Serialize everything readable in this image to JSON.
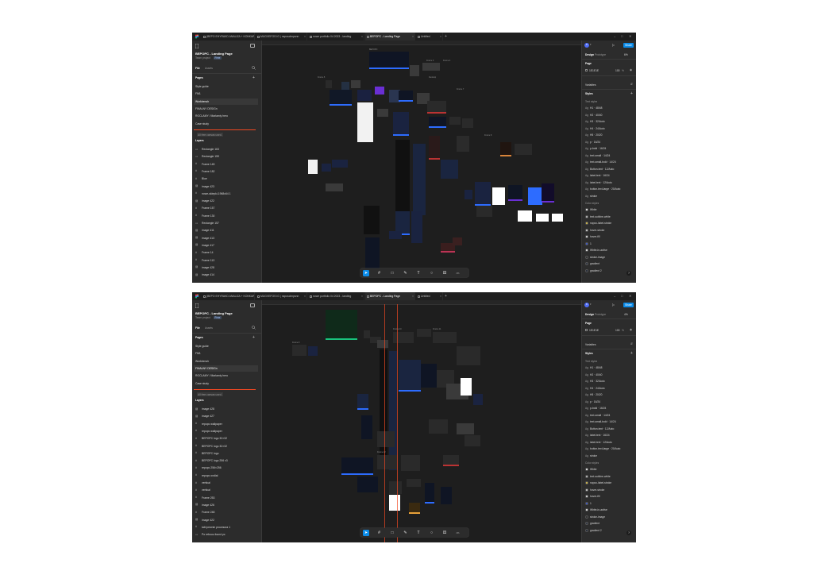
{
  "screenshots": [
    {
      "tabs": [
        {
          "label": "(BEPO EHYRAKD ANALIZA + KONKUR",
          "active": false
        },
        {
          "label": "MUGVEFOS IG | nsposclmpsnn",
          "active": false
        },
        {
          "label": "nowe portfolio 04 2023 - landing",
          "active": false
        },
        {
          "label": "BEPOPC - Landing Page",
          "active": true
        },
        {
          "label": "Untitled",
          "active": false
        }
      ],
      "file": {
        "title": "BEPOPC - Landing Page",
        "team": "Team project",
        "badge": "Free"
      },
      "file_tabs": {
        "file": "File",
        "assets": "Assets"
      },
      "pages_label": "Pages",
      "pages": [
        {
          "name": "Style guide",
          "selected": false
        },
        {
          "name": "FM1",
          "selected": false
        },
        {
          "name": "Workbench",
          "selected": true
        },
        {
          "name": "FINALNY DESIGn",
          "selected": false
        },
        {
          "name": "ROCLAMY / Marlamiy hero",
          "selected": false
        },
        {
          "name": "Case study",
          "selected": false
        }
      ],
      "all_free": "All free canvas used.",
      "layers_label": "Layers",
      "layers": [
        {
          "icon": "rect",
          "name": "Rectangle 163"
        },
        {
          "icon": "rect",
          "name": "Rectangle 159"
        },
        {
          "icon": "frame",
          "name": "Frame 145"
        },
        {
          "icon": "frame",
          "name": "Frame 182"
        },
        {
          "icon": "frame",
          "name": "Blue"
        },
        {
          "icon": "image",
          "name": "image 423"
        },
        {
          "icon": "frame",
          "name": "nowe-sklepki-1968x64 1"
        },
        {
          "icon": "image",
          "name": "image 422"
        },
        {
          "icon": "frame",
          "name": "Frame 157"
        },
        {
          "icon": "frame",
          "name": "Frame 130"
        },
        {
          "icon": "rect",
          "name": "Rectangle 157"
        },
        {
          "icon": "image",
          "name": "image 411"
        },
        {
          "icon": "image",
          "name": "image 413"
        },
        {
          "icon": "image",
          "name": "image 417"
        },
        {
          "icon": "frame",
          "name": "Frame 14"
        },
        {
          "icon": "frame",
          "name": "Frame 113"
        },
        {
          "icon": "image",
          "name": "image 428"
        },
        {
          "icon": "image",
          "name": "image 414"
        }
      ],
      "right": {
        "design": "Design",
        "prototype": "Prototype",
        "zoom": "6%",
        "page_label": "Page",
        "page_color": "1E1E1E",
        "page_opacity": "100",
        "page_percent": "%",
        "variables": "Variables",
        "styles": "Styles",
        "text_styles": "Text styles",
        "text_styles_list": [
          "H1 · 48/48",
          "H2 · 40/40",
          "H3 · 32/Auto",
          "H4 · 24/Auto",
          "H5 · 20/20",
          "p · 16/24",
          "p-bold · 16/24",
          "text-small · 14/24",
          "text-small-bold · 14/24",
          "Button-text · 12/Auto",
          "label-text · 16/24",
          "label-text · 12/Auto",
          "button-text-large · 20/Auto",
          "stroke"
        ],
        "color_styles": "Color styles",
        "colors": [
          {
            "name": "White",
            "hex": "#ffffff"
          },
          {
            "name": "text-subline-white",
            "hex": "#c8c8c8"
          },
          {
            "name": "nopoc-label-stroke",
            "hex": "#e8c94a"
          },
          {
            "name": "hover-stroke",
            "hex": "#dddddd"
          },
          {
            "name": "hover-fill",
            "hex": "#eeeeee"
          },
          {
            "name": "1",
            "hex": "#3b5bdb"
          },
          {
            "name": "White-in-active",
            "hex": "#f5f5f5"
          },
          {
            "name": "stroke-image",
            "hex": "#2a2a2a"
          },
          {
            "name": "gradient",
            "hex": "#2b3140"
          },
          {
            "name": "gradient 2",
            "hex": "#1b2333"
          }
        ]
      }
    },
    {
      "tabs": [
        {
          "label": "(BEPO EHYRAKD ANALIZA + KONKUR",
          "active": false
        },
        {
          "label": "MUGVEFOS IG | nsposclmpsnn",
          "active": false
        },
        {
          "label": "nowe portfolio 04 2023 - landing",
          "active": false
        },
        {
          "label": "BEPOPC - Landing Page",
          "active": true
        },
        {
          "label": "Untitled",
          "active": false
        }
      ],
      "file": {
        "title": "BEPOPC - Landing Page",
        "team": "Team project",
        "badge": "Free"
      },
      "file_tabs": {
        "file": "File",
        "assets": "Assets"
      },
      "pages_label": "Pages",
      "pages": [
        {
          "name": "Style guide",
          "selected": false
        },
        {
          "name": "FM1",
          "selected": false
        },
        {
          "name": "Workbench",
          "selected": false
        },
        {
          "name": "FINALNY DESIGn",
          "selected": true
        },
        {
          "name": "ROCLAMY / Marlamiy hero",
          "selected": false
        },
        {
          "name": "Case study",
          "selected": false
        }
      ],
      "all_free": "All free canvas used.",
      "layers_label": "Layers",
      "layers": [
        {
          "icon": "image",
          "name": "image 428"
        },
        {
          "icon": "image",
          "name": "image 427"
        },
        {
          "icon": "frame",
          "name": "repopc wallpaper"
        },
        {
          "icon": "frame",
          "name": "repopc wallpaper"
        },
        {
          "icon": "frame",
          "name": "BEPOPC logo 32×32"
        },
        {
          "icon": "frame",
          "name": "BEPOPC logo 32×32"
        },
        {
          "icon": "frame",
          "name": "BEPOPC logo"
        },
        {
          "icon": "frame",
          "name": "BEPOPC logo 256 x3"
        },
        {
          "icon": "frame",
          "name": "repopc 256×256"
        },
        {
          "icon": "frame",
          "name": "repopc ondial"
        },
        {
          "icon": "frame",
          "name": "vertical"
        },
        {
          "icon": "frame",
          "name": "vertical"
        },
        {
          "icon": "frame",
          "name": "Frame 253"
        },
        {
          "icon": "image",
          "name": "image 426"
        },
        {
          "icon": "frame",
          "name": "Frame 248"
        },
        {
          "icon": "image",
          "name": "image 422"
        },
        {
          "icon": "frame",
          "name": "tabl pewnie procesora 1"
        },
        {
          "icon": "rect",
          "name": "Po rebouu found pc"
        }
      ],
      "right": {
        "design": "Design",
        "prototype": "Prototype",
        "zoom": "4%",
        "page_label": "Page",
        "page_color": "1E1E1E",
        "page_opacity": "100",
        "page_percent": "%",
        "variables": "Variables",
        "styles": "Styles",
        "text_styles": "Text styles",
        "text_styles_list": [
          "H1 · 48/48",
          "H2 · 40/40",
          "H3 · 32/Auto",
          "H4 · 24/Auto",
          "H5 · 20/20",
          "p · 16/24",
          "p-bold · 16/24",
          "text-small · 14/24",
          "text-small-bold · 14/24",
          "Button-text · 12/Auto",
          "label-text · 16/24",
          "label-text · 12/Auto",
          "button-text-large · 20/Auto",
          "stroke"
        ],
        "color_styles": "Color styles",
        "colors": [
          {
            "name": "White",
            "hex": "#ffffff"
          },
          {
            "name": "text-subline-white",
            "hex": "#c8c8c8"
          },
          {
            "name": "nopoc-label-stroke",
            "hex": "#e8c94a"
          },
          {
            "name": "hover-stroke",
            "hex": "#dddddd"
          },
          {
            "name": "hover-fill",
            "hex": "#eeeeee"
          },
          {
            "name": "1",
            "hex": "#3b5bdb"
          },
          {
            "name": "White-in-active",
            "hex": "#f5f5f5"
          },
          {
            "name": "stroke-image",
            "hex": "#2a2a2a"
          },
          {
            "name": "gradient",
            "hex": "#2b3140"
          },
          {
            "name": "gradient 2",
            "hex": "#1b2333"
          }
        ]
      }
    }
  ],
  "common": {
    "share": "Share",
    "avatar": "B",
    "help": "?",
    "accent": "#0c8ce9",
    "canvas_bg": "#1e1e1e",
    "panel_bg": "#2c2c2c",
    "tools": [
      "move-tool",
      "frame-tool",
      "shape-tool",
      "pen-tool",
      "text-tool",
      "comment-tool",
      "actions-tool",
      "dev-mode-tool"
    ],
    "frame_labels_1": [
      "BEPOPC",
      "Frame 3",
      "Frame 4",
      "Frame 5",
      "Desktop",
      "Frame 7",
      "Frame 8"
    ],
    "frame_labels_2": [
      "Frame 9",
      "Frame 10",
      "Frame 11",
      "Frame 12"
    ]
  }
}
